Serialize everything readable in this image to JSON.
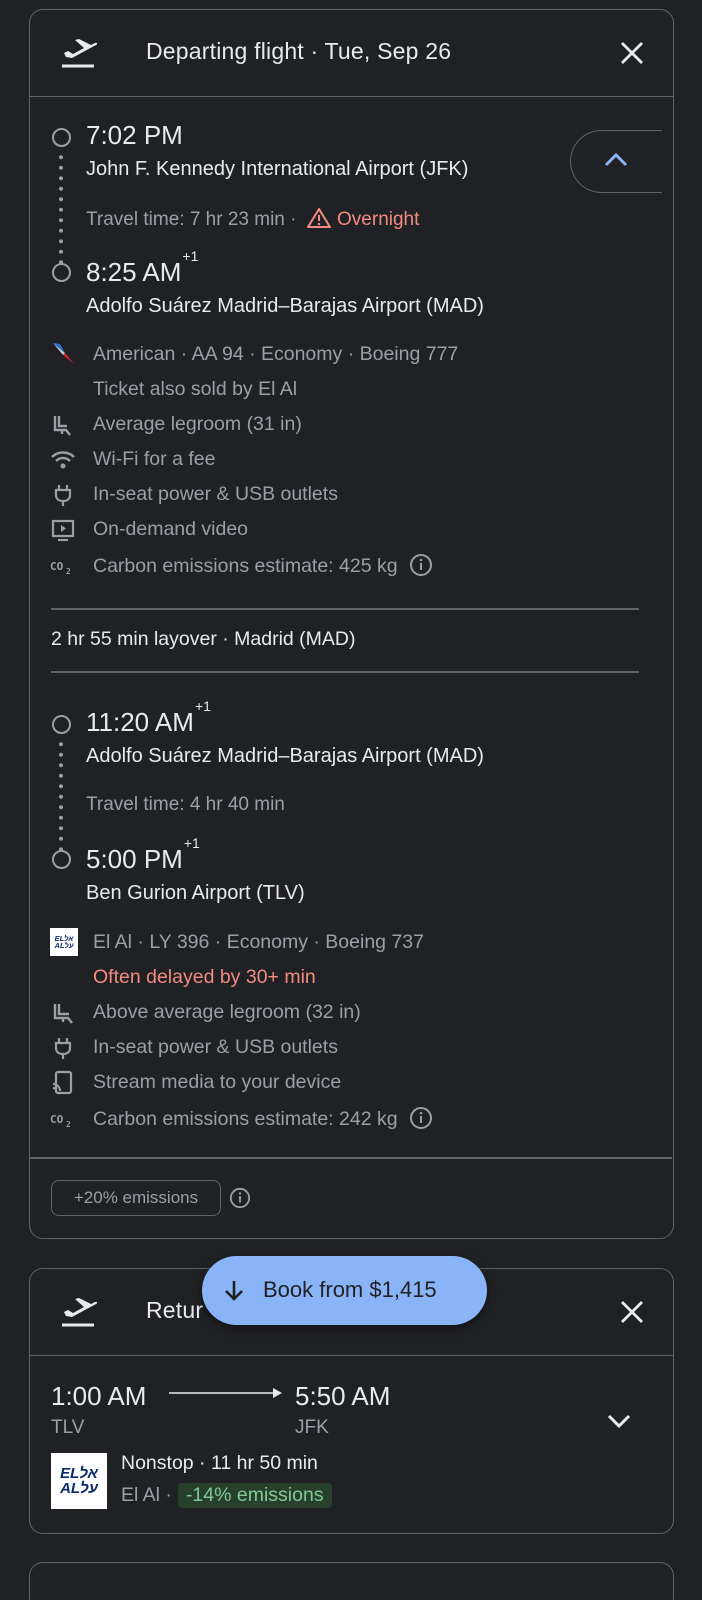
{
  "departing": {
    "title": "Departing flight · Tue, Sep 26",
    "leg1": {
      "dep_time": "7:02 PM",
      "dep_airport": "John F. Kennedy International Airport (JFK)",
      "travel_time": "Travel time: 7 hr 23 min ·",
      "overnight": "Overnight",
      "arr_time": "8:25 AM",
      "arr_day": "+1",
      "arr_airport": "Adolfo Suárez Madrid–Barajas Airport (MAD)",
      "airline_line": "American · AA 94 · Economy · Boeing 777",
      "sold_by": "Ticket also sold by El Al",
      "legroom": "Average legroom (31 in)",
      "wifi": "Wi-Fi for a fee",
      "power": "In-seat power & USB outlets",
      "video": "On-demand video",
      "carbon": "Carbon emissions estimate: 425 kg"
    },
    "layover": "2 hr 55 min layover · Madrid (MAD)",
    "leg2": {
      "dep_time": "11:20 AM",
      "dep_day": "+1",
      "dep_airport": "Adolfo Suárez Madrid–Barajas Airport (MAD)",
      "travel_time": "Travel time: 4 hr 40 min",
      "arr_time": "5:00 PM",
      "arr_day": "+1",
      "arr_airport": "Ben Gurion Airport (TLV)",
      "airline_line": "El Al · LY 396 · Economy · Boeing 737",
      "delay": "Often delayed by 30+ min",
      "legroom": "Above average legroom (32 in)",
      "power": "In-seat power & USB outlets",
      "stream": "Stream media to your device",
      "carbon": "Carbon emissions estimate: 242 kg"
    },
    "emissions_chip": "+20% emissions"
  },
  "book": {
    "label": "Book from $1,415"
  },
  "returning": {
    "title_partial": "Retur",
    "dep_time": "1:00 AM",
    "dep_code": "TLV",
    "arr_time": "5:50 AM",
    "arr_code": "JFK",
    "stops_line": "Nonstop · 11 hr 50 min",
    "airline": "El Al ·",
    "emissions": "-14% emissions"
  },
  "logos": {
    "elal_top": "ELאל",
    "elal_bottom": "ALעל"
  },
  "colors": {
    "background": "#202124",
    "accent": "#8ab4f8",
    "warning": "#f28b82",
    "positive": "#81c995"
  }
}
